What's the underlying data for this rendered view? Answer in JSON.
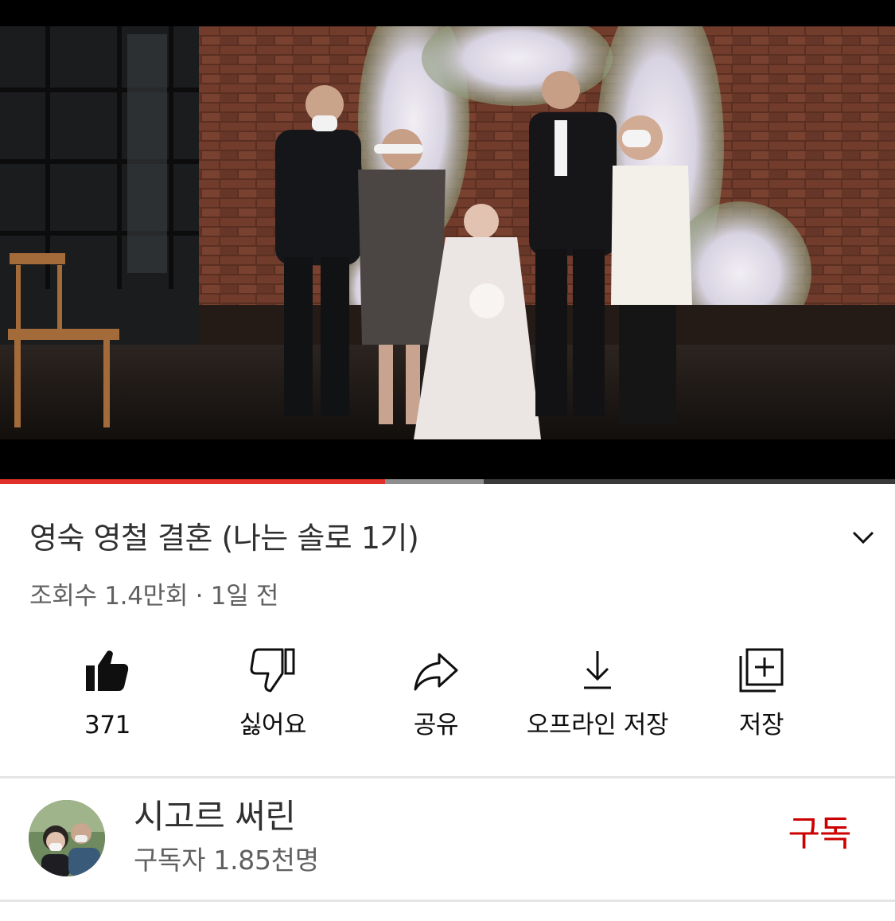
{
  "player": {
    "progress_played": 0.43,
    "progress_buffered": 0.54,
    "accent_color": "#e0302b"
  },
  "video": {
    "title": "영숙 영철 결혼 (나는 솔로 1기)",
    "meta": "조회수 1.4만회 · 1일 전"
  },
  "actions": [
    {
      "icon": "thumbs-up-filled-icon",
      "label": "371"
    },
    {
      "icon": "thumbs-down-icon",
      "label": "싫어요"
    },
    {
      "icon": "share-arrow-icon",
      "label": "공유"
    },
    {
      "icon": "download-icon",
      "label": "오프라인 저장"
    },
    {
      "icon": "playlist-add-icon",
      "label": "저장"
    }
  ],
  "channel": {
    "name": "시고르 써린",
    "subscribers": "구독자 1.85천명",
    "subscribe_label": "구독",
    "subscribe_color": "#cc0000"
  }
}
